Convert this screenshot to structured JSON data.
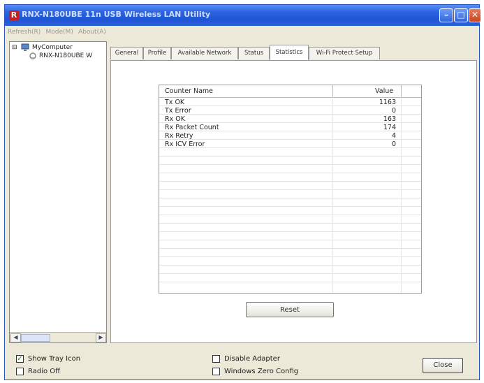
{
  "window": {
    "title": "RNX-N180UBE 11n USB Wireless LAN Utility",
    "icon_letter": "R"
  },
  "menu": [
    {
      "label": "Refresh(R)"
    },
    {
      "label": "Mode(M)"
    },
    {
      "label": "About(A)"
    }
  ],
  "tree": {
    "expander": "⊟",
    "root": "MyComputer",
    "device": "RNX-N180UBE W"
  },
  "tabs": [
    {
      "label": "General"
    },
    {
      "label": "Profile"
    },
    {
      "label": "Available Network"
    },
    {
      "label": "Status"
    },
    {
      "label": "Statistics"
    },
    {
      "label": "Wi-Fi Protect Setup"
    }
  ],
  "statistics": {
    "headers": {
      "name": "Counter Name",
      "value": "Value"
    },
    "rows": [
      {
        "name": "Tx OK",
        "value": "1163"
      },
      {
        "name": "Tx Error",
        "value": "0"
      },
      {
        "name": "Rx OK",
        "value": "163"
      },
      {
        "name": "Rx Packet Count",
        "value": "174"
      },
      {
        "name": "Rx Retry",
        "value": "4"
      },
      {
        "name": "Rx ICV Error",
        "value": "0"
      }
    ],
    "reset_label": "Reset"
  },
  "bottom": {
    "show_tray_icon": {
      "label": "Show Tray Icon",
      "checked": true
    },
    "radio_off": {
      "label": "Radio Off",
      "checked": false
    },
    "disable_adapter": {
      "label": "Disable Adapter",
      "checked": false
    },
    "windows_zero_config": {
      "label": "Windows Zero Config",
      "checked": false
    },
    "close_label": "Close"
  },
  "colors": {
    "titlebar": "#2a63e0",
    "window_bg": "#ece9d8",
    "close_button": "#c7441f"
  }
}
